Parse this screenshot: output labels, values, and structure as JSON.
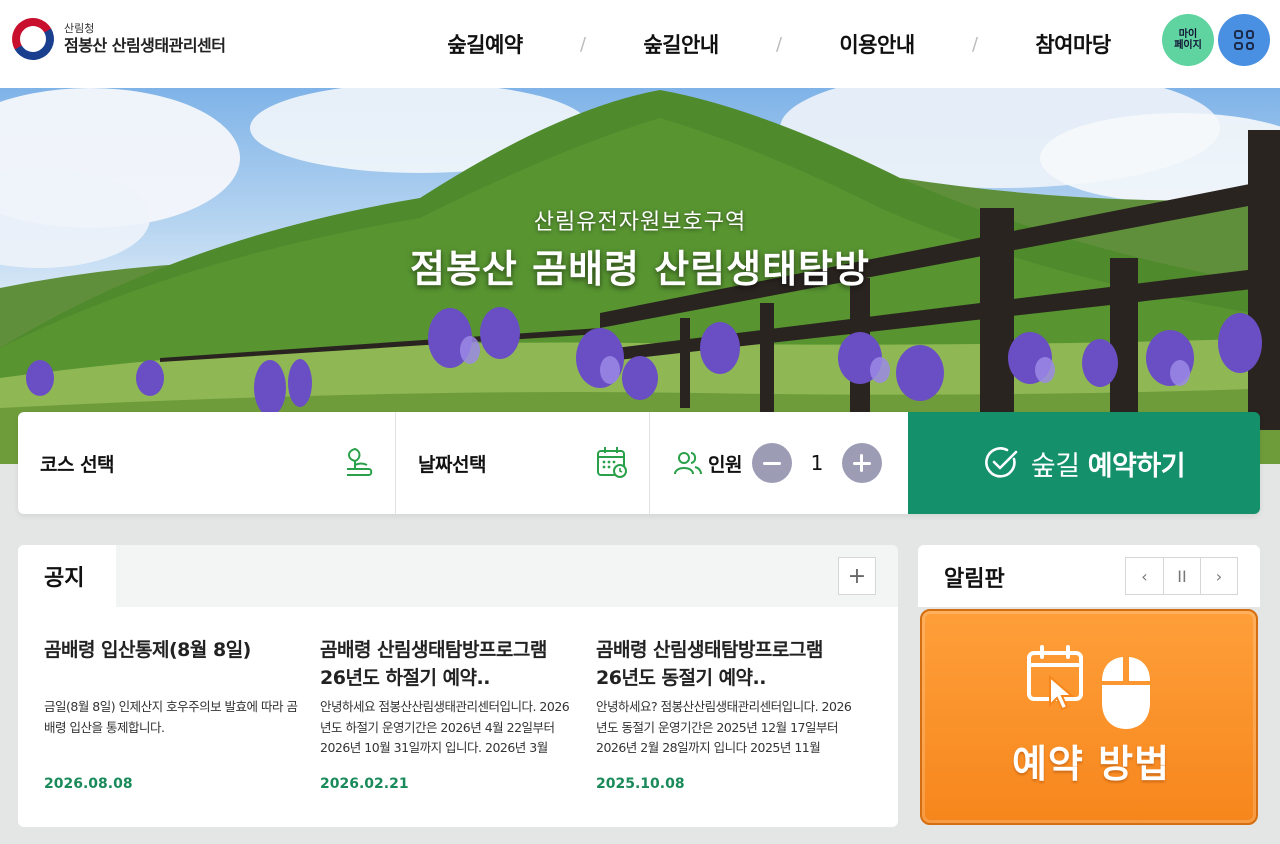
{
  "header": {
    "logo_small": "산림청",
    "logo_main": "점봉산 산림생태관리센터",
    "nav": [
      "숲길예약",
      "숲길안내",
      "이용안내",
      "참여마당"
    ],
    "nav_separator": "/",
    "mypage_line1": "마이",
    "mypage_line2": "페이지"
  },
  "hero": {
    "subtitle": "산림유전자원보호구역",
    "title": "점봉산 곰배령 산림생태탐방"
  },
  "booking": {
    "course_label": "코스 선택",
    "date_label": "날짜선택",
    "people_label": "인원",
    "people_count": "1",
    "reserve_prefix": "숲길 ",
    "reserve_bold": "예약하기"
  },
  "notice": {
    "title": "공지",
    "more": "+",
    "items": [
      {
        "title": "곰배령 입산통제(8월 8일)",
        "desc": "금일(8월 8일) 인제산지 호우주의보 발효에 따라 곰배령 입산을 통제합니다.",
        "date": "2026.08.08"
      },
      {
        "title": "곰배령 산림생태탐방프로그램 26년도 하절기 예약..",
        "desc": "안녕하세요 점봉산산림생태관리센터입니다. 2026년도 하절기 운영기간은 2026년 4월 22일부터 2026년 10월 31일까지 입니다. 2026년 3월",
        "date": "2026.02.21"
      },
      {
        "title": "곰배령 산림생태탐방프로그램 26년도 동절기 예약..",
        "desc": "안녕하세요? 점봉산산림생태관리센터입니다. 2026년도 동절기 운영기간은 2025년 12월 17일부터 2026년 2월 28일까지 입니다 2025년 11월",
        "date": "2025.10.08"
      }
    ]
  },
  "board": {
    "title": "알림판",
    "prev": "‹",
    "pause": "II",
    "next": "›",
    "banner_text": "예약 방법"
  },
  "colors": {
    "accent_green": "#14906b",
    "date_green": "#1b8a5a",
    "banner_orange": "#f6861c",
    "mypage_green": "#5fd3a0",
    "menu_blue": "#4a90e2"
  },
  "icons": [
    "sprout-icon",
    "calendar-icon",
    "people-icon",
    "check-circle-icon",
    "calendar-cursor-icon",
    "mouse-icon",
    "grid-menu-icon"
  ]
}
